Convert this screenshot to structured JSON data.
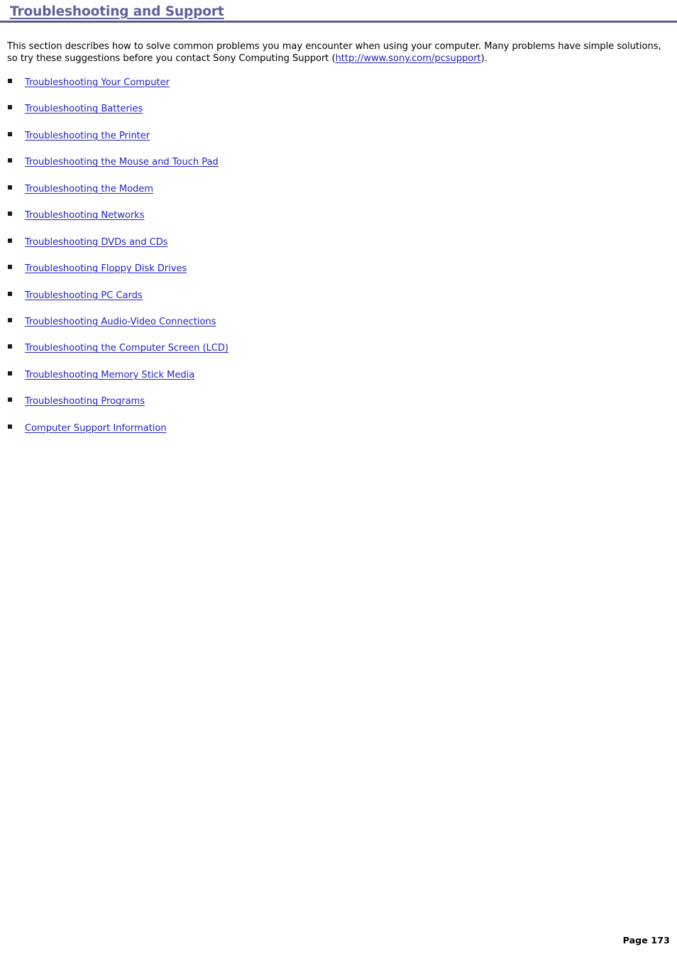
{
  "document": {
    "title": "Troubleshooting and Support",
    "title_color": "#5f5f99",
    "rule_color": "#5a5a96",
    "link_color": "#2222cc",
    "bullet_color": "#1a1a1a",
    "background_color": "#ffffff"
  },
  "intro": {
    "text_before_link": "This section describes how to solve common problems you may encounter when using your computer. Many problems have simple solutions, so try these suggestions before you contact Sony Computing Support (",
    "link_text": "http://www.sony.com/pcsupport",
    "link_href": "http://www.sony.com/pcsupport",
    "text_after_link": ")."
  },
  "toc": {
    "items": [
      {
        "label": "Troubleshooting Your Computer"
      },
      {
        "label": "Troubleshooting Batteries"
      },
      {
        "label": "Troubleshooting the Printer"
      },
      {
        "label": "Troubleshooting the Mouse and Touch Pad"
      },
      {
        "label": "Troubleshooting the Modem"
      },
      {
        "label": "Troubleshooting Networks"
      },
      {
        "label": "Troubleshooting DVDs and CDs"
      },
      {
        "label": "Troubleshooting Floppy Disk Drives"
      },
      {
        "label": "Troubleshooting PC Cards"
      },
      {
        "label": "Troubleshooting Audio-Video Connections"
      },
      {
        "label": "Troubleshooting the Computer Screen (LCD)"
      },
      {
        "label": "Troubleshooting Memory Stick Media"
      },
      {
        "label": "Troubleshooting Programs"
      },
      {
        "label": "Computer Support Information"
      }
    ]
  },
  "footer": {
    "page_label": "Page 173"
  }
}
